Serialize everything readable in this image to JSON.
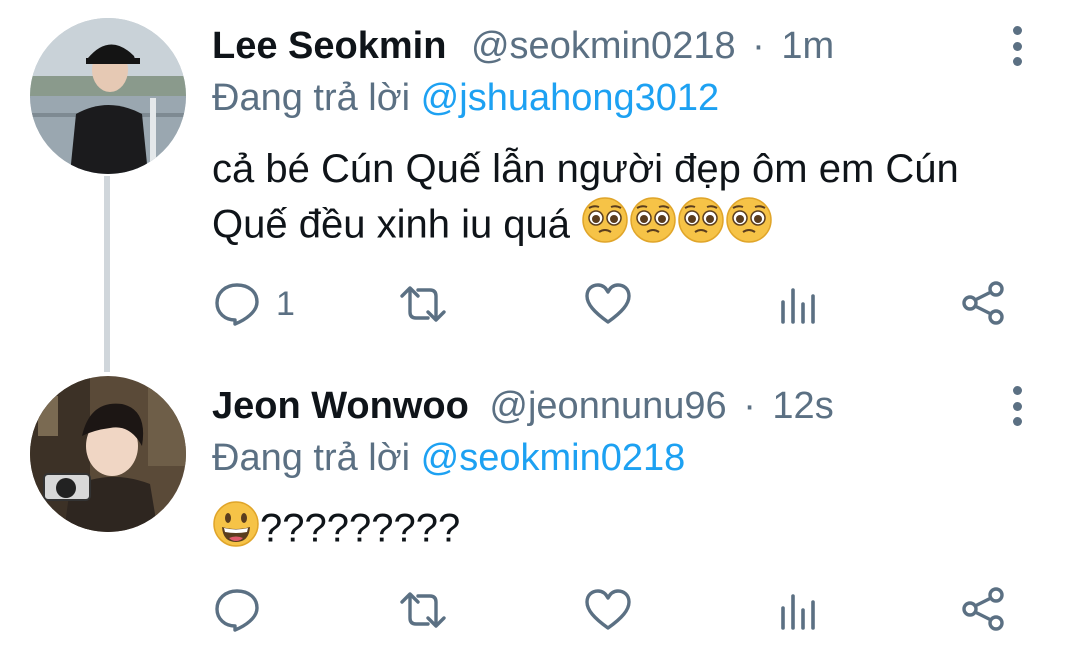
{
  "tweets": [
    {
      "display_name": "Lee Seokmin",
      "handle": "@seokmin0218",
      "separator": "·",
      "time": "1m",
      "reply_prefix": "Đang trả lời",
      "reply_to": "@jshuahong3012",
      "text_line1": "cả bé Cún Quế lẫn người đẹp  ôm em Cún",
      "text_line2": "Quế đều xinh iu quá",
      "emojis": [
        "pleading-face",
        "pleading-face",
        "pleading-face",
        "pleading-face"
      ],
      "reply_count": "1"
    },
    {
      "display_name": "Jeon Wonwoo",
      "handle": "@jeonnunu96",
      "separator": "·",
      "time": "12s",
      "reply_prefix": "Đang trả lời",
      "reply_to": "@seokmin0218",
      "emoji": "grinning-face",
      "text": "?????????",
      "reply_count": ""
    }
  ],
  "colors": {
    "text": "#0f1419",
    "muted": "#5b7083",
    "link": "#1da1f2",
    "thread_line": "#d0d6db"
  }
}
